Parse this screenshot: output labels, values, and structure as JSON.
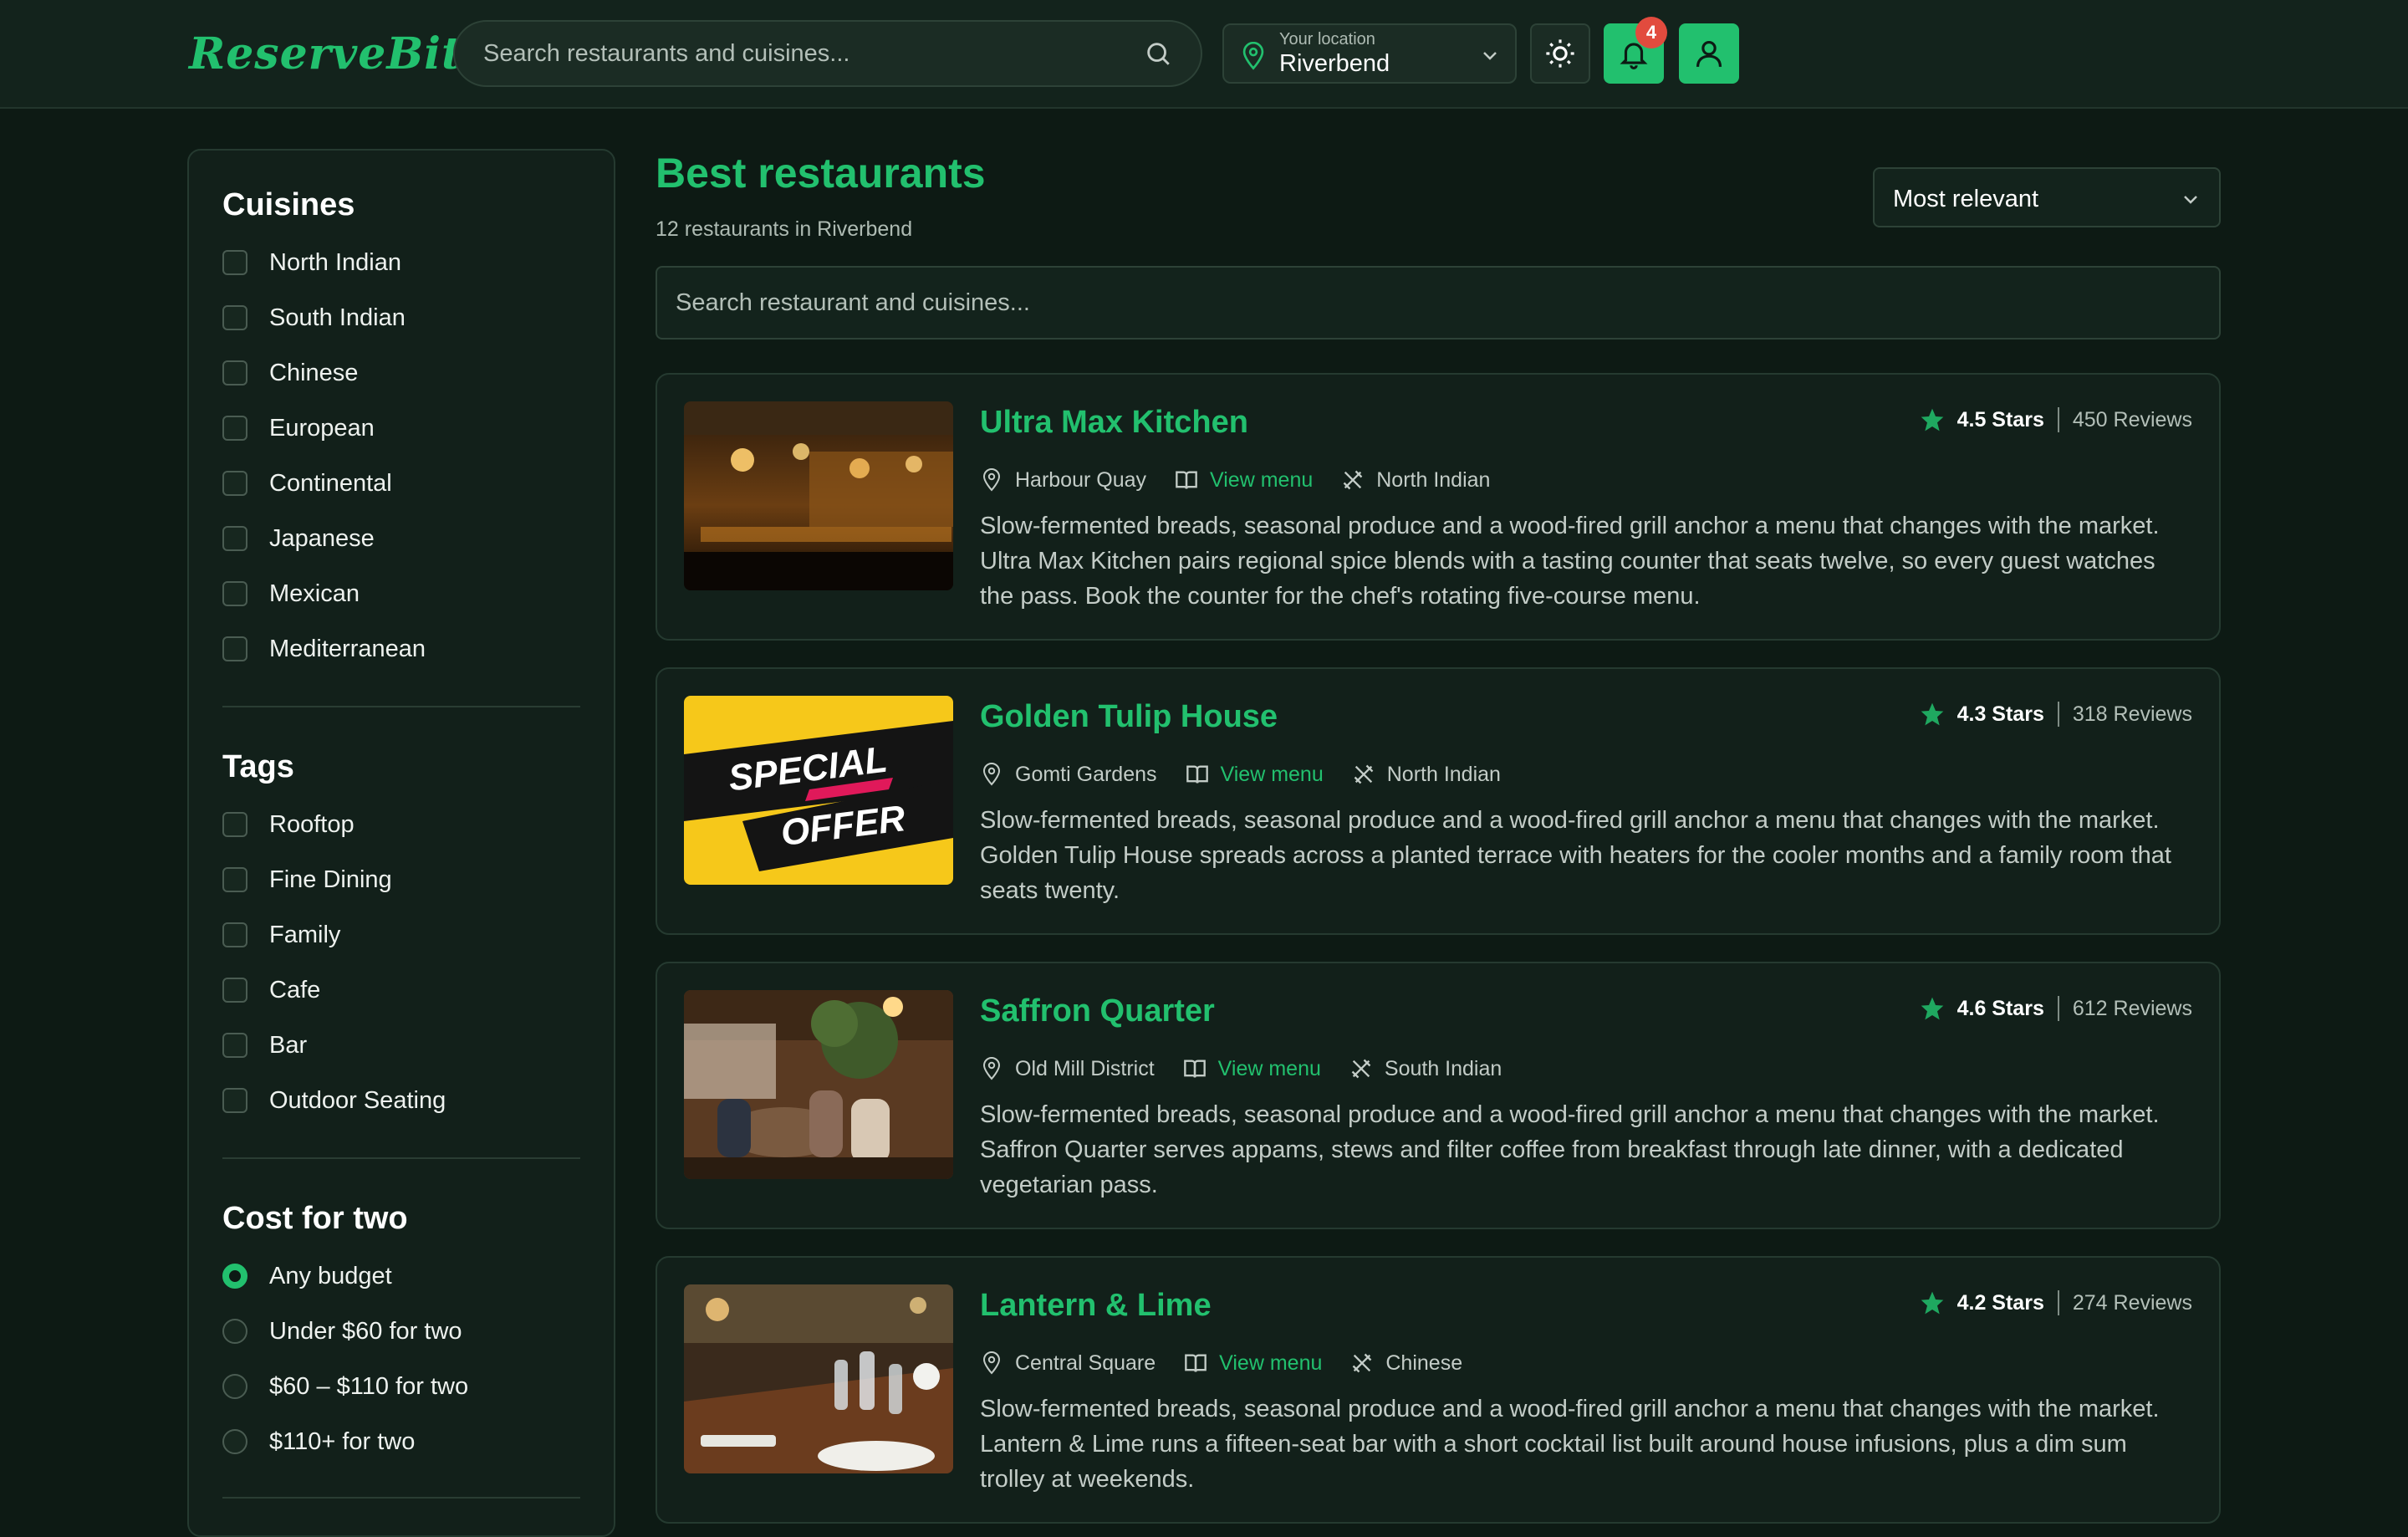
{
  "header": {
    "logo": "ReserveBite",
    "search_placeholder": "Search restaurants and cuisines...",
    "location_label": "Your location",
    "location_value": "Riverbend",
    "notification_count": "4"
  },
  "sidebar": {
    "cuisines_title": "Cuisines",
    "cuisines": [
      "North Indian",
      "South Indian",
      "Chinese",
      "European",
      "Continental",
      "Japanese",
      "Mexican",
      "Mediterranean"
    ],
    "tags_title": "Tags",
    "tags": [
      "Rooftop",
      "Fine Dining",
      "Family",
      "Cafe",
      "Bar",
      "Outdoor Seating"
    ],
    "cost_title": "Cost for two",
    "cost_options": [
      "Any budget",
      "Under $60 for two",
      "$60 – $110 for two",
      "$110+ for two"
    ],
    "cost_selected": "Any budget"
  },
  "main": {
    "title": "Best restaurants",
    "subtitle": "12 restaurants in Riverbend",
    "sort_value": "Most relevant",
    "search_placeholder": "Search restaurant and cuisines...",
    "view_menu_label": "View menu",
    "restaurants": [
      {
        "name": "Ultra Max Kitchen",
        "area": "Harbour Quay",
        "cuisine": "North Indian",
        "stars": "4.5 Stars",
        "reviews": "450 Reviews",
        "description": "Slow-fermented breads, seasonal produce and a wood-fired grill anchor a menu that changes with the market. Ultra Max Kitchen pairs regional spice blends with a tasting counter that seats twelve, so every guest watches the pass. Book the counter for the chef's rotating five-course menu."
      },
      {
        "name": "Golden Tulip House",
        "area": "Gomti Gardens",
        "cuisine": "North Indian",
        "stars": "4.3 Stars",
        "reviews": "318 Reviews",
        "description": "Slow-fermented breads, seasonal produce and a wood-fired grill anchor a menu that changes with the market. Golden Tulip House spreads across a planted terrace with heaters for the cooler months and a family room that seats twenty.",
        "image_text": [
          "SPECIAL",
          "OFFER"
        ]
      },
      {
        "name": "Saffron Quarter",
        "area": "Old Mill District",
        "cuisine": "South Indian",
        "stars": "4.6 Stars",
        "reviews": "612 Reviews",
        "description": "Slow-fermented breads, seasonal produce and a wood-fired grill anchor a menu that changes with the market. Saffron Quarter serves appams, stews and filter coffee from breakfast through late dinner, with a dedicated vegetarian pass."
      },
      {
        "name": "Lantern & Lime",
        "area": "Central Square",
        "cuisine": "Chinese",
        "stars": "4.2 Stars",
        "reviews": "274 Reviews",
        "description": "Slow-fermented breads, seasonal produce and a wood-fired grill anchor a menu that changes with the market. Lantern & Lime runs a fifteen-seat bar with a short cocktail list built around house infusions, plus a dim sum trolley at weekends."
      }
    ]
  },
  "colors": {
    "accent": "#22c06e",
    "background": "#0d1a14",
    "badge": "#e24b3e"
  },
  "icons": {
    "search": "search-icon",
    "location": "map-pin-icon",
    "theme": "sun-icon",
    "notifications": "bell-icon",
    "account": "user-icon",
    "menu": "book-open-icon",
    "cuisine": "utensils-crossed-icon",
    "rating": "star-icon"
  }
}
